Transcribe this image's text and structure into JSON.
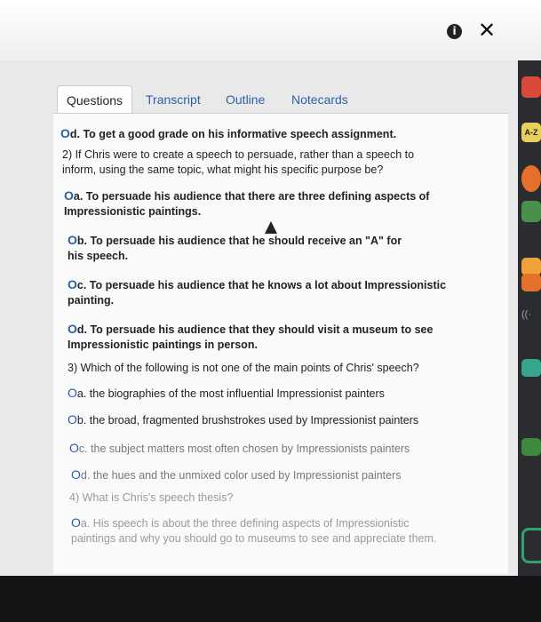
{
  "window": {
    "info_icon": "info-icon",
    "close_icon": "close-icon"
  },
  "tabs": [
    {
      "label": "Questions",
      "active": true
    },
    {
      "label": "Transcript"
    },
    {
      "label": "Outline"
    },
    {
      "label": "Notecards"
    }
  ],
  "q1_option_d": "d. To get a good grade on his informative speech assignment.",
  "q2": {
    "question": "2) If Chris were to create a speech to persuade, rather than a speech to inform, using the same topic, what might his specific purpose be?",
    "options": [
      "a. To persuade his audience that there are three defining aspects of Impressionistic paintings.",
      "b. To persuade his audience that he should receive an \"A\" for his speech.",
      "c. To persuade his audience that he knows a lot about Impressionistic painting.",
      "d. To persuade his audience that they should visit a museum to see Impressionistic paintings in person."
    ]
  },
  "q3": {
    "question": "3) Which of the following is not one of the main points of Chris' speech?",
    "options": [
      "a. the biographies of the most influential Impressionist painters",
      "b. the broad, fragmented brushstrokes used by Impressionist painters",
      "c. the subject matters most often chosen by Impressionists painters",
      "d. the hues and the unmixed color used by Impressionist painters"
    ]
  },
  "q4": {
    "question": "4) What is Chris's speech thesis?",
    "options": [
      "a. His speech is about the three defining aspects of Impressionistic paintings and why you should go to museums to see and appreciate them."
    ]
  },
  "sidebar": {
    "az_label": "A-Z"
  }
}
